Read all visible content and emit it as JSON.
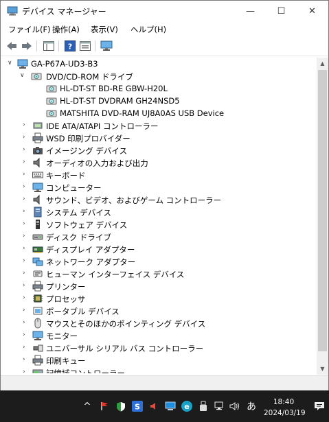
{
  "window": {
    "title": "デバイス マネージャー",
    "minimize": "—",
    "maximize": "☐",
    "close": "✕"
  },
  "menu": [
    "ファイル(F)",
    "操作(A)",
    "表示(V)",
    "ヘルプ(H)"
  ],
  "tree": {
    "root": "GA-P67A-UD3-B3",
    "expanded_category": "DVD/CD-ROM ドライブ",
    "dvd_devices": [
      "HL-DT-ST BD-RE  GBW-H20L",
      "HL-DT-ST DVDRAM GH24NSD5",
      "MATSHITA DVD-RAM UJ8A0AS USB Device"
    ],
    "categories": [
      {
        "label": "IDE ATA/ATAPI コントローラー",
        "icon": "ide-controller-icon"
      },
      {
        "label": "WSD 印刷プロバイダー",
        "icon": "printer-icon"
      },
      {
        "label": "イメージング デバイス",
        "icon": "camera-icon"
      },
      {
        "label": "オーディオの入力および出力",
        "icon": "speaker-icon"
      },
      {
        "label": "キーボード",
        "icon": "keyboard-icon"
      },
      {
        "label": "コンピューター",
        "icon": "monitor-icon"
      },
      {
        "label": "サウンド、ビデオ、およびゲーム コントローラー",
        "icon": "speaker-icon"
      },
      {
        "label": "システム デバイス",
        "icon": "system-device-icon"
      },
      {
        "label": "ソフトウェア デバイス",
        "icon": "software-device-icon"
      },
      {
        "label": "ディスク ドライブ",
        "icon": "disk-drive-icon"
      },
      {
        "label": "ディスプレイ アダプター",
        "icon": "display-adapter-icon"
      },
      {
        "label": "ネットワーク アダプター",
        "icon": "network-adapter-icon"
      },
      {
        "label": "ヒューマン インターフェイス デバイス",
        "icon": "hid-icon"
      },
      {
        "label": "プリンター",
        "icon": "printer-icon"
      },
      {
        "label": "プロセッサ",
        "icon": "processor-icon"
      },
      {
        "label": "ポータブル デバイス",
        "icon": "portable-device-icon"
      },
      {
        "label": "マウスとそのほかのポインティング デバイス",
        "icon": "mouse-icon"
      },
      {
        "label": "モニター",
        "icon": "monitor-icon"
      },
      {
        "label": "ユニバーサル シリアル バス コントローラー",
        "icon": "usb-icon"
      },
      {
        "label": "印刷キュー",
        "icon": "printer-icon"
      },
      {
        "label": "記憶域コントローラー",
        "icon": "storage-controller-icon"
      }
    ]
  },
  "taskbar": {
    "ime": "あ",
    "time": "18:40",
    "date": "2024/03/19"
  },
  "colors": {
    "taskbar": "#1c1c1c",
    "accent": "#0078d7",
    "window_border": "#7a7a7a"
  }
}
